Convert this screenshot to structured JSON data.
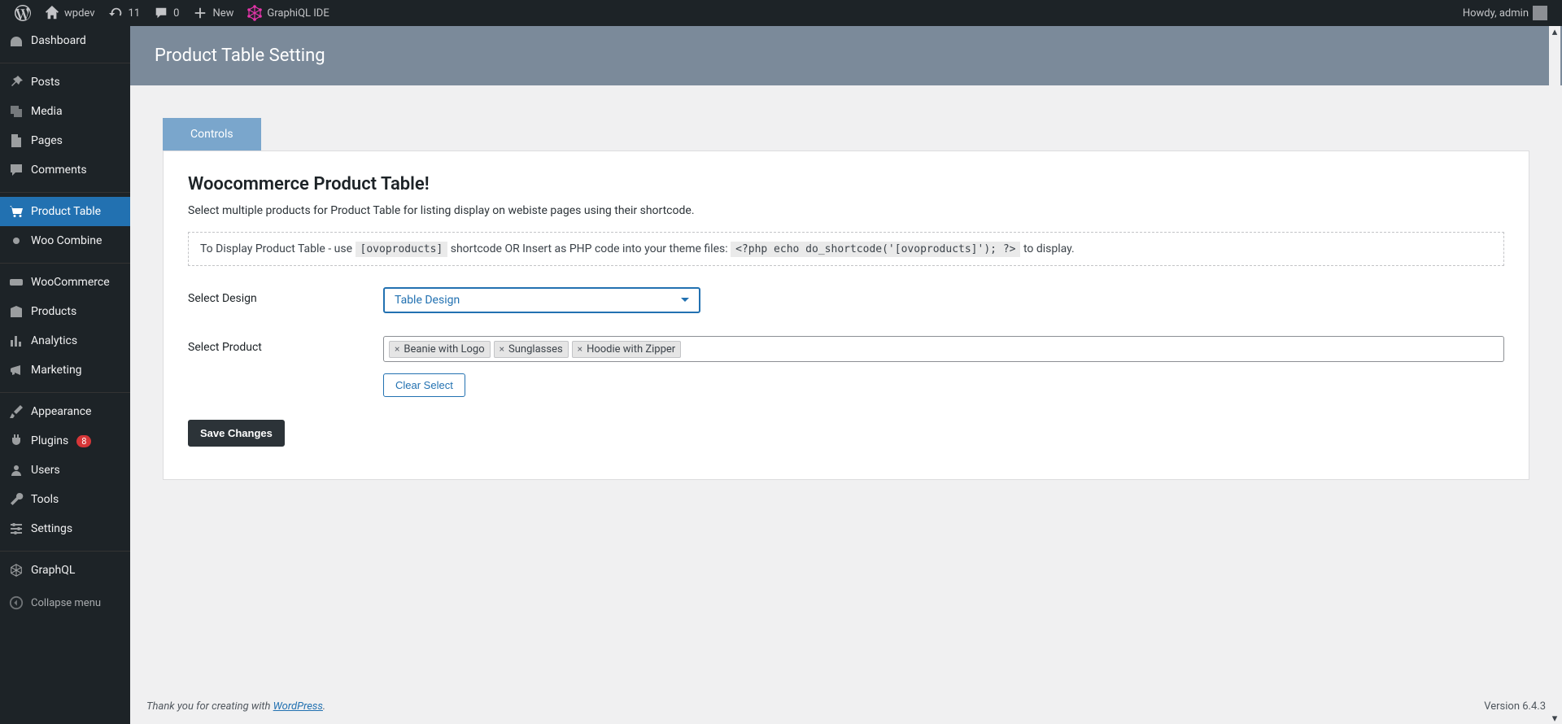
{
  "adminbar": {
    "site_name": "wpdev",
    "updates_count": "11",
    "comments_count": "0",
    "new_label": "New",
    "graphiql_label": "GraphiQL IDE",
    "howdy_label": "Howdy, admin"
  },
  "sidebar": {
    "items": [
      {
        "label": "Dashboard",
        "icon": "dashboard-icon"
      },
      {
        "label": "Posts",
        "icon": "pin-icon"
      },
      {
        "label": "Media",
        "icon": "media-icon"
      },
      {
        "label": "Pages",
        "icon": "pages-icon"
      },
      {
        "label": "Comments",
        "icon": "comment-icon"
      },
      {
        "label": "Product Table",
        "icon": "cart-icon",
        "active": true
      },
      {
        "label": "Woo Combine",
        "icon": "dot-icon"
      },
      {
        "label": "WooCommerce",
        "icon": "woo-icon"
      },
      {
        "label": "Products",
        "icon": "box-icon"
      },
      {
        "label": "Analytics",
        "icon": "chart-icon"
      },
      {
        "label": "Marketing",
        "icon": "megaphone-icon"
      },
      {
        "label": "Appearance",
        "icon": "brush-icon"
      },
      {
        "label": "Plugins",
        "icon": "plug-icon",
        "badge": "8"
      },
      {
        "label": "Users",
        "icon": "user-icon"
      },
      {
        "label": "Tools",
        "icon": "wrench-icon"
      },
      {
        "label": "Settings",
        "icon": "sliders-icon"
      },
      {
        "label": "GraphQL",
        "icon": "graphql-icon"
      }
    ],
    "collapse_label": "Collapse menu"
  },
  "page": {
    "title": "Product Table Setting",
    "tab_label": "Controls",
    "heading": "Woocommerce Product Table!",
    "description": "Select multiple products for Product Table for listing display on webiste pages using their shortcode.",
    "notice_prefix": "To Display Product Table - use ",
    "notice_code1": "[ovoproducts]",
    "notice_mid": " shortcode OR Insert as PHP code into your theme files: ",
    "notice_code2": "<?php echo do_shortcode('[ovoproducts]'); ?>",
    "notice_suffix": " to display.",
    "design_label": "Select Design",
    "design_value": "Table Design",
    "product_label": "Select Product",
    "selected_products": [
      "Beanie with Logo",
      "Sunglasses",
      "Hoodie with Zipper"
    ],
    "clear_label": "Clear Select",
    "save_label": "Save Changes"
  },
  "footer": {
    "thanks_prefix": "Thank you for creating with ",
    "wp_link": "WordPress",
    "thanks_suffix": ".",
    "version": "Version 6.4.3"
  }
}
